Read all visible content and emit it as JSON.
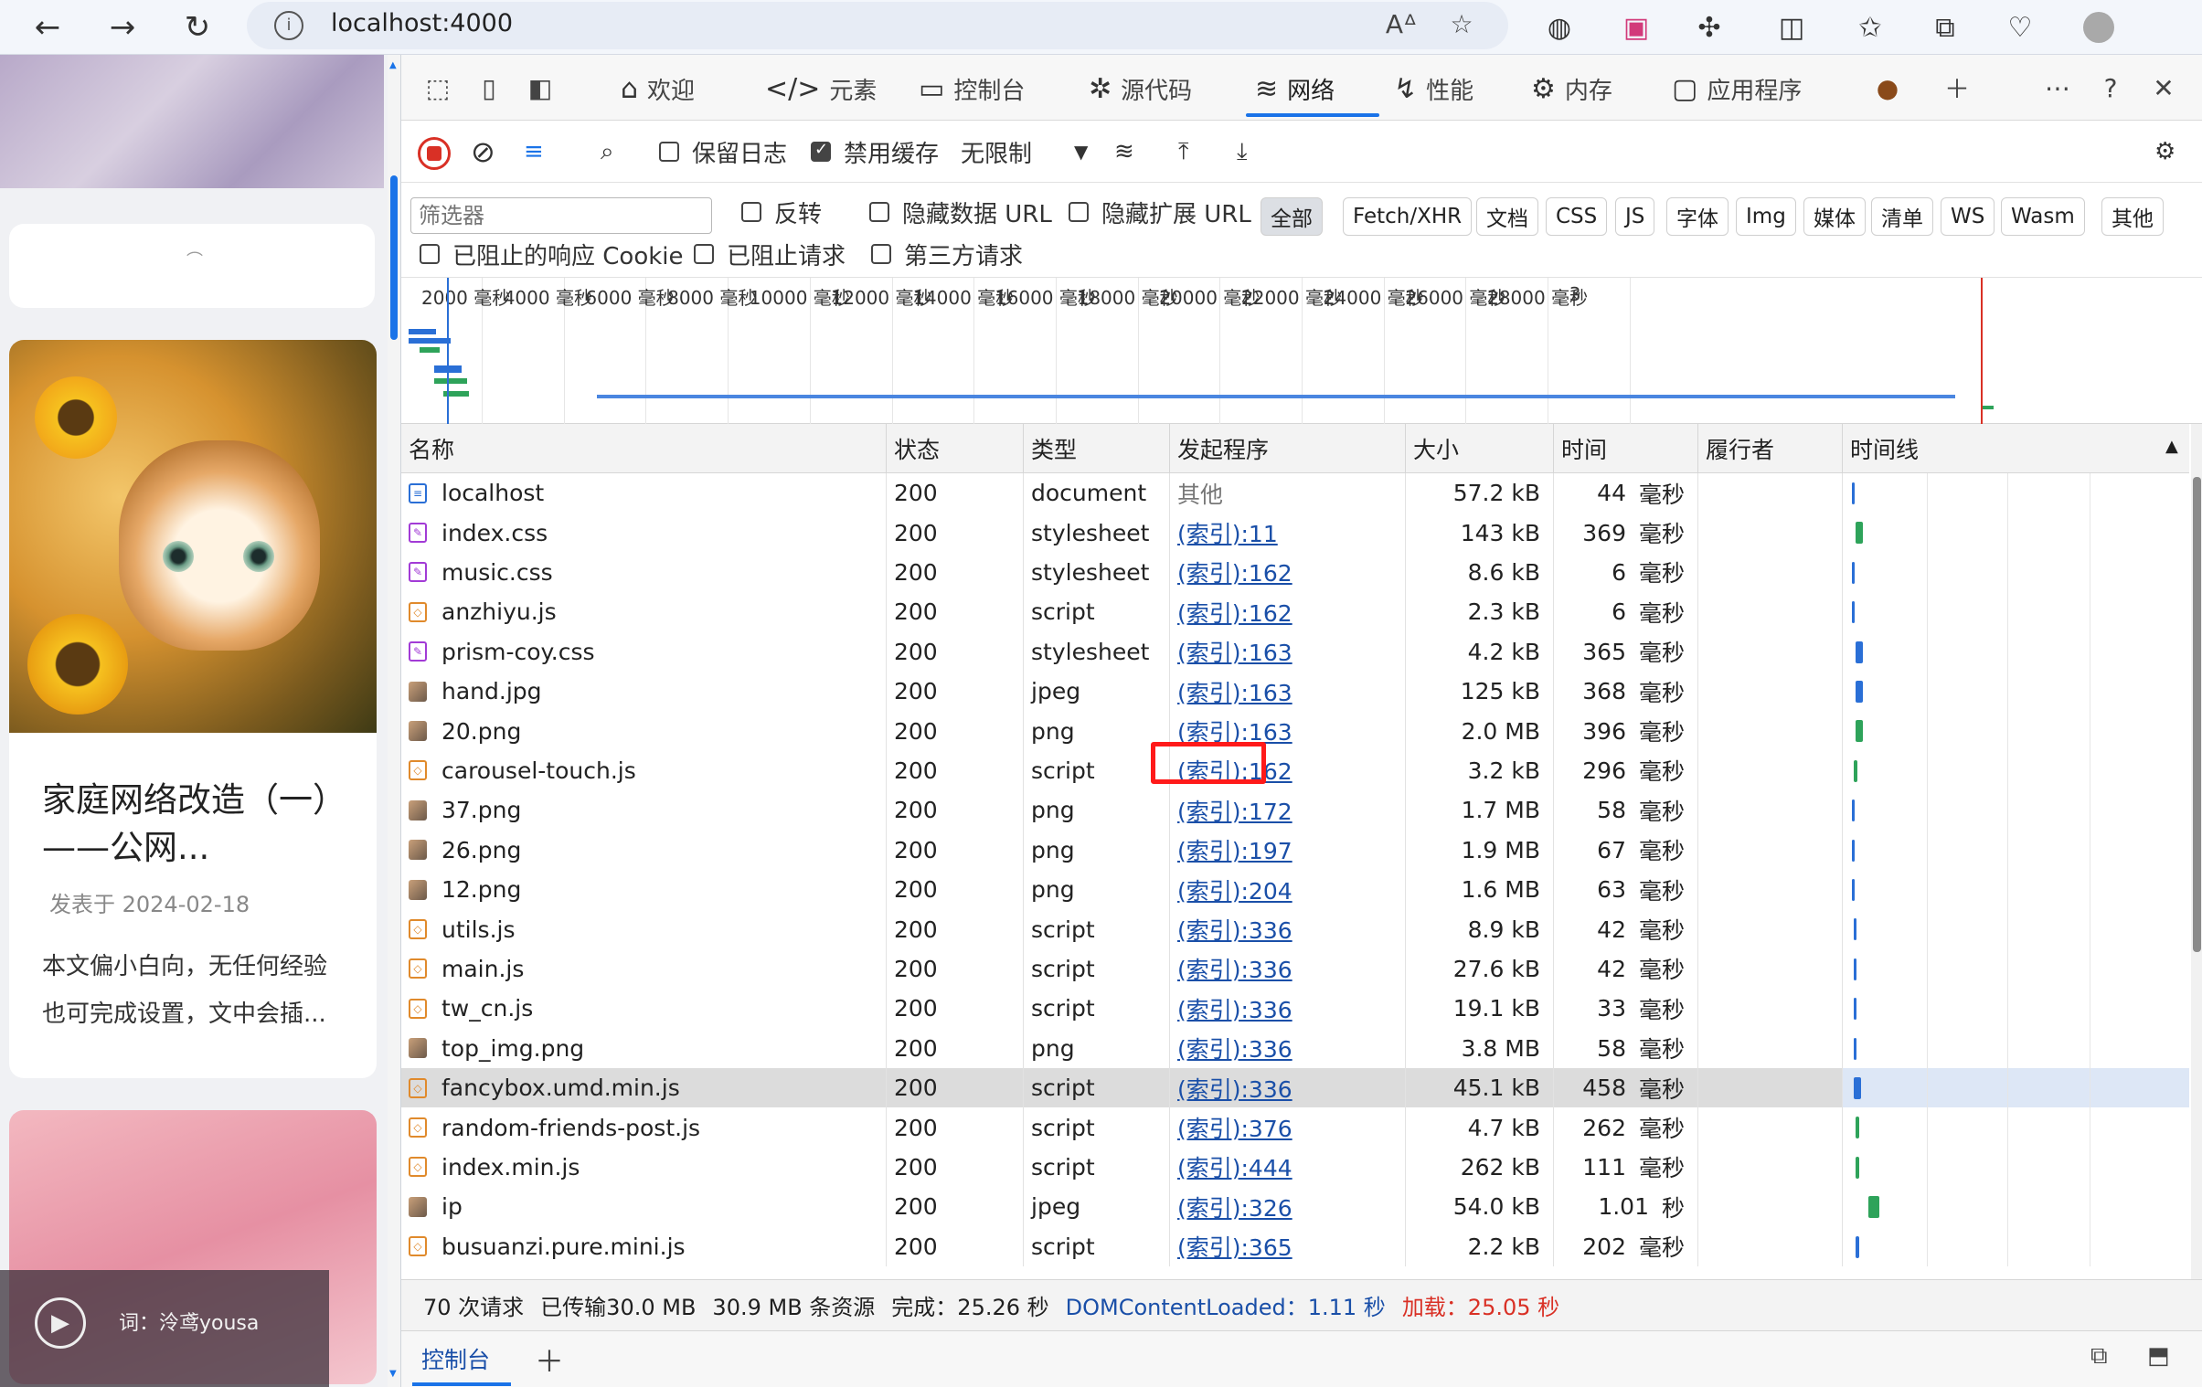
{
  "browser": {
    "url": "localhost:4000",
    "back_icon": "arrow-left-icon",
    "forward_icon": "arrow-right-icon",
    "reload_icon": "reload-icon"
  },
  "page": {
    "post_title": "家庭网络改造（一）——公网...",
    "post_date": "发表于 2024-02-18",
    "post_excerpt": "本文偏小白向，无任何经验也可完成设置，文中会插...",
    "music_text": "词：泠鸢yousa"
  },
  "devtools": {
    "tabs": [
      {
        "label": "欢迎",
        "icon": "home-icon"
      },
      {
        "label": "元素",
        "icon": "code-icon"
      },
      {
        "label": "控制台",
        "icon": "console-icon"
      },
      {
        "label": "源代码",
        "icon": "bug-icon"
      },
      {
        "label": "网络",
        "icon": "wifi-icon"
      },
      {
        "label": "性能",
        "icon": "performance-icon"
      },
      {
        "label": "内存",
        "icon": "memory-icon"
      },
      {
        "label": "应用程序",
        "icon": "application-icon"
      }
    ],
    "toolbar": {
      "preserve_log": "保留日志",
      "disable_cache": "禁用缓存",
      "throttle": "无限制"
    },
    "filter": {
      "placeholder": "筛选器",
      "invert": "反转",
      "hide_data_url": "隐藏数据 URL",
      "hide_ext_url": "隐藏扩展 URL",
      "types": [
        "全部",
        "Fetch/XHR",
        "文档",
        "CSS",
        "JS",
        "字体",
        "Img",
        "媒体",
        "清单",
        "WS",
        "Wasm",
        "其他"
      ],
      "blocked_cookies": "已阻止的响应 Cookie",
      "blocked_requests": "已阻止请求",
      "third_party": "第三方请求"
    },
    "overview_ticks": [
      "2000 毫秒",
      "4000 毫秒",
      "6000 毫秒",
      "8000 毫秒",
      "10000 毫秒",
      "12000 毫秒",
      "14000 毫秒",
      "16000 毫秒",
      "18000 毫秒",
      "20000 毫秒",
      "22000 毫秒",
      "24000 毫秒",
      "26000 毫秒",
      "28000 毫秒",
      "3"
    ],
    "columns": [
      "名称",
      "状态",
      "类型",
      "发起程序",
      "大小",
      "时间",
      "履行者",
      "时间线"
    ],
    "rows": [
      {
        "name": "localhost",
        "status": "200",
        "type": "document",
        "initiator": "其他",
        "size": "57.2 kB",
        "time": "44",
        "unit": "毫秒",
        "icon": "doc"
      },
      {
        "name": "index.css",
        "status": "200",
        "type": "stylesheet",
        "initiator": "(索引):11",
        "size": "143 kB",
        "time": "369",
        "unit": "毫秒",
        "icon": "css"
      },
      {
        "name": "music.css",
        "status": "200",
        "type": "stylesheet",
        "initiator": "(索引):162",
        "size": "8.6 kB",
        "time": "6",
        "unit": "毫秒",
        "icon": "css"
      },
      {
        "name": "anzhiyu.js",
        "status": "200",
        "type": "script",
        "initiator": "(索引):162",
        "size": "2.3 kB",
        "time": "6",
        "unit": "毫秒",
        "icon": "js"
      },
      {
        "name": "prism-coy.css",
        "status": "200",
        "type": "stylesheet",
        "initiator": "(索引):163",
        "size": "4.2 kB",
        "time": "365",
        "unit": "毫秒",
        "icon": "css"
      },
      {
        "name": "hand.jpg",
        "status": "200",
        "type": "jpeg",
        "initiator": "(索引):163",
        "size": "125 kB",
        "time": "368",
        "unit": "毫秒",
        "icon": "img"
      },
      {
        "name": "20.png",
        "status": "200",
        "type": "png",
        "initiator": "(索引):163",
        "size": "2.0 MB",
        "time": "396",
        "unit": "毫秒",
        "icon": "img"
      },
      {
        "name": "carousel-touch.js",
        "status": "200",
        "type": "script",
        "initiator": "(索引):162",
        "size": "3.2 kB",
        "time": "296",
        "unit": "毫秒",
        "icon": "js"
      },
      {
        "name": "37.png",
        "status": "200",
        "type": "png",
        "initiator": "(索引):172",
        "size": "1.7 MB",
        "time": "58",
        "unit": "毫秒",
        "icon": "img"
      },
      {
        "name": "26.png",
        "status": "200",
        "type": "png",
        "initiator": "(索引):197",
        "size": "1.9 MB",
        "time": "67",
        "unit": "毫秒",
        "icon": "img"
      },
      {
        "name": "12.png",
        "status": "200",
        "type": "png",
        "initiator": "(索引):204",
        "size": "1.6 MB",
        "time": "63",
        "unit": "毫秒",
        "icon": "img"
      },
      {
        "name": "utils.js",
        "status": "200",
        "type": "script",
        "initiator": "(索引):336",
        "size": "8.9 kB",
        "time": "42",
        "unit": "毫秒",
        "icon": "js"
      },
      {
        "name": "main.js",
        "status": "200",
        "type": "script",
        "initiator": "(索引):336",
        "size": "27.6 kB",
        "time": "42",
        "unit": "毫秒",
        "icon": "js"
      },
      {
        "name": "tw_cn.js",
        "status": "200",
        "type": "script",
        "initiator": "(索引):336",
        "size": "19.1 kB",
        "time": "33",
        "unit": "毫秒",
        "icon": "js"
      },
      {
        "name": "top_img.png",
        "status": "200",
        "type": "png",
        "initiator": "(索引):336",
        "size": "3.8 MB",
        "time": "58",
        "unit": "毫秒",
        "icon": "img"
      },
      {
        "name": "fancybox.umd.min.js",
        "status": "200",
        "type": "script",
        "initiator": "(索引):336",
        "size": "45.1 kB",
        "time": "458",
        "unit": "毫秒",
        "icon": "js",
        "selected": true
      },
      {
        "name": "random-friends-post.js",
        "status": "200",
        "type": "script",
        "initiator": "(索引):376",
        "size": "4.7 kB",
        "time": "262",
        "unit": "毫秒",
        "icon": "js"
      },
      {
        "name": "index.min.js",
        "status": "200",
        "type": "script",
        "initiator": "(索引):444",
        "size": "262 kB",
        "time": "111",
        "unit": "毫秒",
        "icon": "js"
      },
      {
        "name": "ip",
        "status": "200",
        "type": "jpeg",
        "initiator": "(索引):326",
        "size": "54.0 kB",
        "time": "1.01",
        "unit": "秒",
        "icon": "img"
      },
      {
        "name": "busuanzi.pure.mini.js",
        "status": "200",
        "type": "script",
        "initiator": "(索引):365",
        "size": "2.2 kB",
        "time": "202",
        "unit": "毫秒",
        "icon": "js"
      }
    ],
    "status_bar": {
      "requests": "70 次请求",
      "transferred": "已传输30.0 MB",
      "resources": "30.9 MB 条资源",
      "finish": "完成：25.26 秒",
      "dom_loaded": "DOMContentLoaded：1.11 秒",
      "load": "加载：25.05 秒"
    },
    "drawer_tab": "控制台",
    "colors": {
      "accent": "#1a73e8",
      "record": "#d93025",
      "highlight_box": "#ff1a1a",
      "link": "#1a4fa8",
      "load": "#d93025"
    }
  }
}
